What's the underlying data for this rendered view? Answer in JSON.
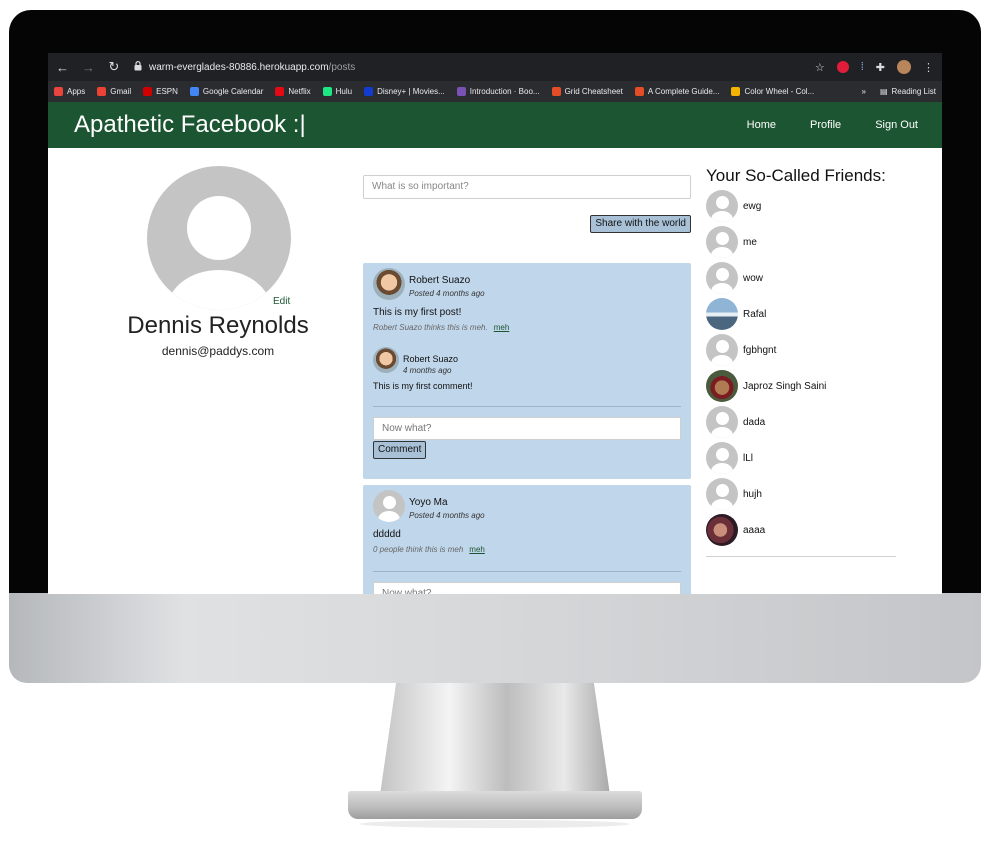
{
  "browser": {
    "url_host": "warm-everglades-80886.herokuapp.com",
    "url_path": "/posts",
    "bookmarks": [
      {
        "label": "Apps",
        "color": "#e8453c"
      },
      {
        "label": "Gmail",
        "color": "#ea4335"
      },
      {
        "label": "ESPN",
        "color": "#d00000"
      },
      {
        "label": "Google Calendar",
        "color": "#4285f4"
      },
      {
        "label": "Netflix",
        "color": "#e50914"
      },
      {
        "label": "Hulu",
        "color": "#1ce783"
      },
      {
        "label": "Disney+ | Movies...",
        "color": "#113ccf"
      },
      {
        "label": "Introduction · Boo...",
        "color": "#7952b3"
      },
      {
        "label": "Grid Cheatsheet",
        "color": "#e44d26"
      },
      {
        "label": "A Complete Guide...",
        "color": "#e44d26"
      },
      {
        "label": "Color Wheel - Col...",
        "color": "#f4b400"
      }
    ],
    "overflow_label": "»",
    "reading_list": "Reading List"
  },
  "navbar": {
    "brand": "Apathetic Facebook :|",
    "links": [
      "Home",
      "Profile",
      "Sign Out"
    ],
    "color": "#1c5532"
  },
  "profile": {
    "edit": "Edit",
    "name": "Dennis Reynolds",
    "email": "dennis@paddys.com"
  },
  "composer": {
    "placeholder": "What is so important?",
    "share_label": "Share with the world"
  },
  "posts": [
    {
      "author": "Robert Suazo",
      "meta": "Posted 4 months ago",
      "body": "This is my first post!",
      "meh_text": "Robert Suazo thinks this is meh.",
      "meh_link": "meh",
      "comment": {
        "author": "Robert Suazo",
        "meta": "4 months ago",
        "body": "This is my first comment!"
      },
      "comment_placeholder": "Now what?",
      "comment_button": "Comment"
    },
    {
      "author": "Yoyo Ma",
      "meta": "Posted 4 months ago",
      "body": "ddddd",
      "meh_text": "0 people think this is meh",
      "meh_link": "meh",
      "comment_placeholder": "Now what?"
    }
  ],
  "friends": {
    "title": "Your So-Called Friends:",
    "list": [
      {
        "name": "ewg",
        "avatar": "default"
      },
      {
        "name": "me",
        "avatar": "default"
      },
      {
        "name": "wow",
        "avatar": "default"
      },
      {
        "name": "Rafal",
        "avatar": "photo"
      },
      {
        "name": "fgbhgnt",
        "avatar": "default"
      },
      {
        "name": "Japroz Singh Saini",
        "avatar": "photo"
      },
      {
        "name": "dada",
        "avatar": "default"
      },
      {
        "name": "lLl",
        "avatar": "default"
      },
      {
        "name": "hujh",
        "avatar": "default"
      },
      {
        "name": "aaaa",
        "avatar": "photo"
      }
    ]
  }
}
